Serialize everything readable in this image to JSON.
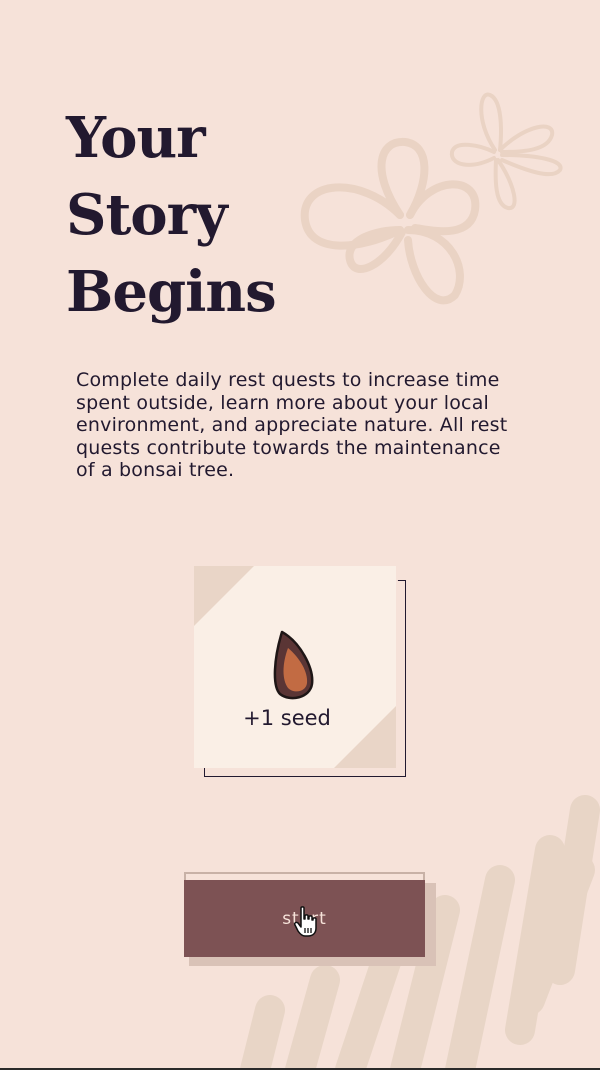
{
  "title": {
    "lines": [
      "Your",
      "Story",
      "Begins"
    ]
  },
  "intro": {
    "text": "Complete daily rest quests to increase time spent outside, learn more about your local environment, and appreciate nature. All rest quests contribute towards the maintenance of a bonsai tree."
  },
  "reward_card": {
    "icon": "seed-icon",
    "label": "+1 seed"
  },
  "start_button": {
    "label": "start"
  },
  "colors": {
    "background": "#f6e2d9",
    "text": "#22192f",
    "button": "#7d5254",
    "card": "#faefe6",
    "seed": "#c26b43"
  }
}
